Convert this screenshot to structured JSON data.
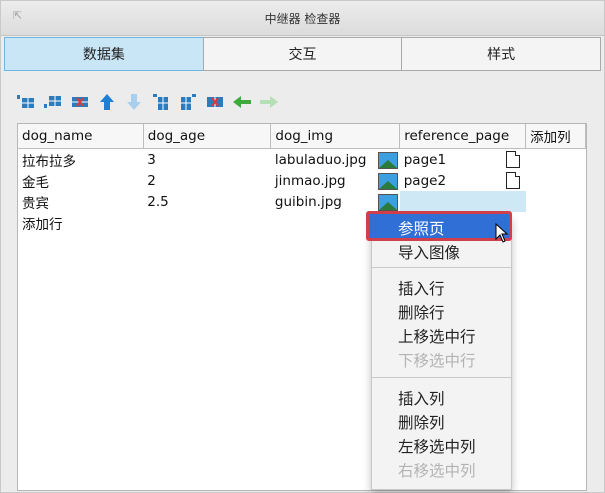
{
  "window": {
    "title": "中继器 检查器"
  },
  "tabs": [
    {
      "label": "数据集",
      "active": true
    },
    {
      "label": "交互",
      "active": false
    },
    {
      "label": "样式",
      "active": false
    }
  ],
  "toolbar": {
    "icons": [
      "insert-row-above-icon",
      "insert-row-below-icon",
      "delete-row-icon",
      "move-up-icon",
      "move-down-icon",
      "insert-column-left-icon",
      "insert-column-right-icon",
      "delete-column-icon",
      "move-left-icon",
      "move-right-icon"
    ]
  },
  "table": {
    "headers": [
      "dog_name",
      "dog_age",
      "dog_img",
      "reference_page",
      "添加列"
    ],
    "rows": [
      {
        "dog_name": "拉布拉多",
        "dog_age": "3",
        "dog_img": "labuladuo.jpg",
        "reference_page": "page1"
      },
      {
        "dog_name": "金毛",
        "dog_age": "2",
        "dog_img": "jinmao.jpg",
        "reference_page": "page2"
      },
      {
        "dog_name": "贵宾",
        "dog_age": "2.5",
        "dog_img": "guibin.jpg",
        "reference_page": ""
      }
    ],
    "add_row": "添加行"
  },
  "context_menu": {
    "highlighted": "参照页",
    "items1": [
      "导入图像"
    ],
    "items2": [
      {
        "label": "插入行",
        "disabled": false
      },
      {
        "label": "删除行",
        "disabled": false
      },
      {
        "label": "上移选中行",
        "disabled": false
      },
      {
        "label": "下移选中行",
        "disabled": true
      }
    ],
    "items3": [
      {
        "label": "插入列",
        "disabled": false
      },
      {
        "label": "删除列",
        "disabled": false
      },
      {
        "label": "左移选中列",
        "disabled": false
      },
      {
        "label": "右移选中列",
        "disabled": true
      }
    ]
  },
  "colors": {
    "accent": "#2f6fd6",
    "tab_active": "#c9e6f7",
    "highlight_border": "#d13f4a"
  }
}
